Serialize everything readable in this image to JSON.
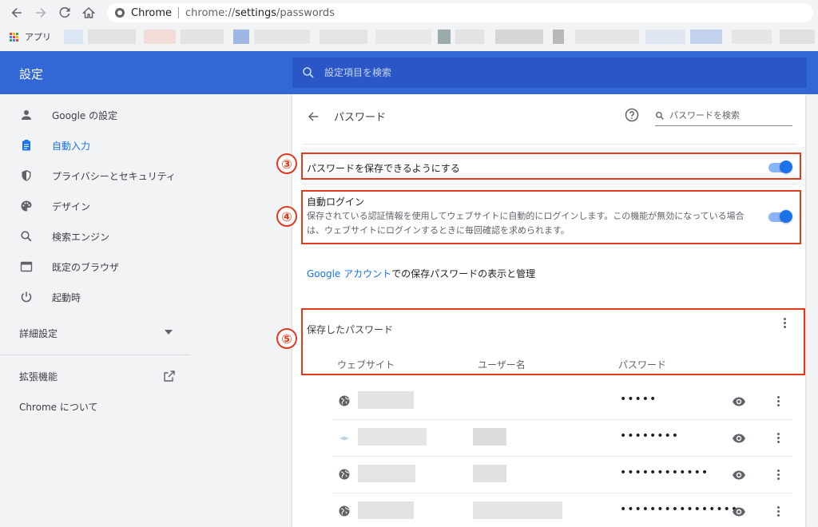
{
  "browser": {
    "origin": "Chrome",
    "url_scheme": "chrome://",
    "url_host": "settings",
    "url_path": "/passwords",
    "bookmarks_apps_label": "アプリ"
  },
  "header": {
    "title": "設定",
    "search_placeholder": "設定項目を検索"
  },
  "sidebar": {
    "items": [
      {
        "label": "Google の設定",
        "icon": "person-icon"
      },
      {
        "label": "自動入力",
        "icon": "clipboard-icon",
        "active": true
      },
      {
        "label": "プライバシーとセキュリティ",
        "icon": "shield-icon"
      },
      {
        "label": "デザイン",
        "icon": "palette-icon"
      },
      {
        "label": "検索エンジン",
        "icon": "search-icon"
      },
      {
        "label": "既定のブラウザ",
        "icon": "browser-icon"
      },
      {
        "label": "起動時",
        "icon": "power-icon"
      }
    ],
    "advanced_label": "詳細設定",
    "extensions_label": "拡張機能",
    "about_label": "Chrome について"
  },
  "main": {
    "page_title": "パスワード",
    "search_placeholder": "パスワードを検索",
    "offer_to_save": {
      "label": "パスワードを保存できるようにする",
      "enabled": true
    },
    "auto_signin": {
      "label": "自動ログイン",
      "description": "保存されている認証情報を使用してウェブサイトに自動的にログインします。この機能が無効になっている場合は、ウェブサイトにログインするときに毎回確認を求められます。",
      "enabled": true
    },
    "account_link": {
      "link_text": "Google アカウント",
      "rest_text": "での保存パスワードの表示と管理"
    },
    "saved_passwords": {
      "title": "保存したパスワード",
      "columns": [
        "ウェブサイト",
        "ユーザー名",
        "パスワード"
      ],
      "rows": [
        {
          "password_mask": "•••••"
        },
        {
          "password_mask": "••••••••"
        },
        {
          "password_mask": "••••••••••••"
        },
        {
          "password_mask": "••••••••••••••••"
        }
      ]
    }
  },
  "annotations": [
    "③",
    "④",
    "⑤"
  ],
  "colors": {
    "header_blue": "#3367d6",
    "accent": "#1a73e8",
    "annotation_red": "#e03a1f"
  }
}
